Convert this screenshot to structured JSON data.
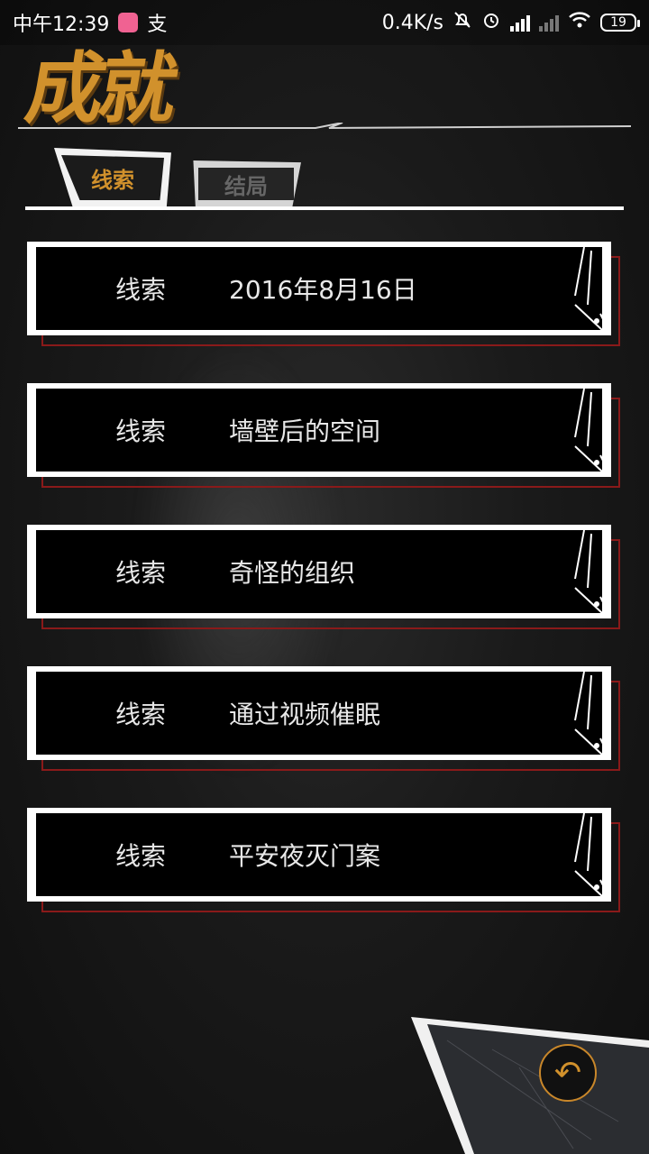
{
  "status_bar": {
    "time": "中午12:39",
    "app_icon_text": "支",
    "net_speed": "0.4K/s",
    "battery": "19"
  },
  "header": {
    "title": "成就"
  },
  "tabs": [
    {
      "label": "线索",
      "active": true
    },
    {
      "label": "结局",
      "active": false
    }
  ],
  "clues": [
    {
      "tag": "线索",
      "name": "2016年8月16日"
    },
    {
      "tag": "线索",
      "name": "墙壁后的空间"
    },
    {
      "tag": "线索",
      "name": "奇怪的组织"
    },
    {
      "tag": "线索",
      "name": "通过视频催眠"
    },
    {
      "tag": "线索",
      "name": "平安夜灭门案"
    }
  ],
  "back_button": {
    "icon": "back-arrow-icon"
  },
  "colors": {
    "accent": "#d1912c",
    "shadow_border": "#8a1a1a"
  }
}
